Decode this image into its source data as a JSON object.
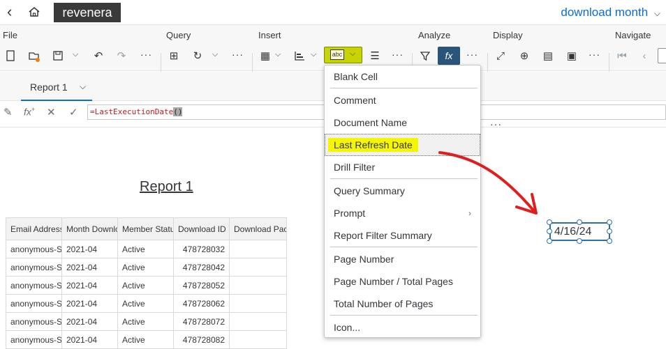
{
  "header": {
    "brand": "revenera",
    "document_title": "download month"
  },
  "toolbar": {
    "groups": {
      "file": "File",
      "query": "Query",
      "insert": "Insert",
      "analyze": "Analyze",
      "display": "Display",
      "navigate": "Navigate"
    },
    "more": "···",
    "fx": "fx",
    "insert_text_icon": "abc"
  },
  "tabs": [
    {
      "label": "Report 1"
    }
  ],
  "formula": {
    "text": "=LastExecutionDate",
    "parens": "()"
  },
  "report": {
    "title": "Report 1",
    "columns": [
      "Email Address",
      "Month Download",
      "Member Status",
      "Download ID",
      "Download Package"
    ],
    "rows": [
      [
        "anonymous-S",
        "2021-04",
        "Active",
        "478728032",
        ""
      ],
      [
        "anonymous-S",
        "2021-04",
        "Active",
        "478728042",
        ""
      ],
      [
        "anonymous-S",
        "2021-04",
        "Active",
        "478728052",
        ""
      ],
      [
        "anonymous-S",
        "2021-04",
        "Active",
        "478728062",
        ""
      ],
      [
        "anonymous-S",
        "2021-04",
        "Active",
        "478728072",
        ""
      ],
      [
        "anonymous-S",
        "2021-04",
        "Active",
        "478728082",
        ""
      ]
    ]
  },
  "menu": {
    "items": [
      "Blank Cell",
      "Comment",
      "Document Name",
      "Last Refresh Date",
      "Drill Filter",
      "Query Summary",
      "Prompt",
      "Report Filter Summary",
      "Page Number",
      "Page Number / Total Pages",
      "Total Number of Pages",
      "Icon..."
    ],
    "highlighted": "Last Refresh Date"
  },
  "cell": {
    "value": "4/16/24"
  },
  "colors": {
    "accent": "#0a6ed1",
    "highlight": "#f6f600",
    "arrow": "#e01e1e",
    "selection": "#2f6ea8"
  }
}
